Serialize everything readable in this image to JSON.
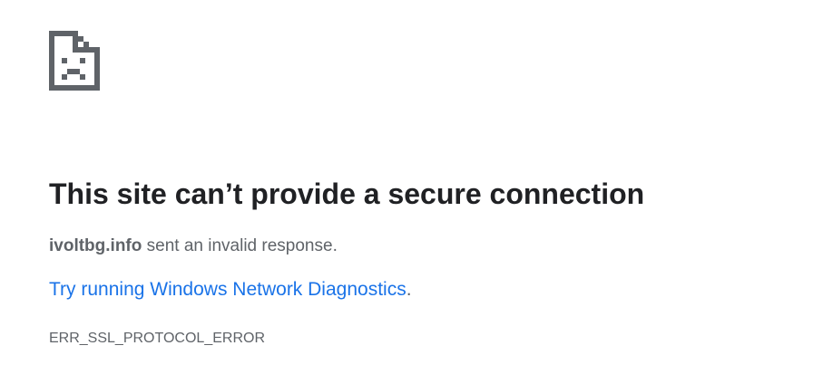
{
  "error_icon": {
    "name": "sad-page-icon",
    "color": "#5f6368"
  },
  "heading": "This site can’t provide a secure connection",
  "description": {
    "host": "ivoltbg.info",
    "rest": " sent an invalid response."
  },
  "suggestion": {
    "link_text": "Try running Windows Network Diagnostics",
    "suffix": ".",
    "link_color": "#1a73e8"
  },
  "error_code": "ERR_SSL_PROTOCOL_ERROR"
}
